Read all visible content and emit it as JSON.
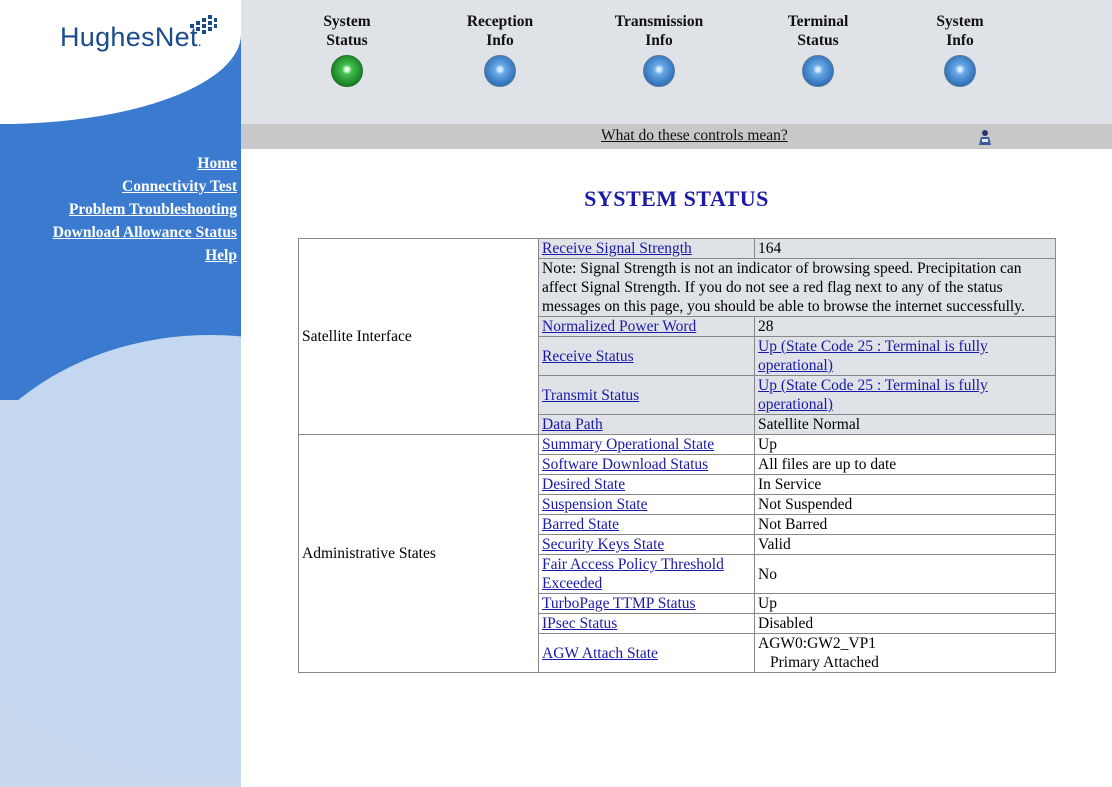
{
  "logo": {
    "text": "HughesNet",
    "trademark": "."
  },
  "sidebar": {
    "links": [
      "Home",
      "Connectivity Test",
      "Problem Troubleshooting",
      "Download Allowance Status",
      "Help"
    ]
  },
  "topnav": {
    "tabs": [
      {
        "label": "System\nStatus",
        "active": true
      },
      {
        "label": "Reception\nInfo",
        "active": false
      },
      {
        "label": "Transmission\nInfo",
        "active": false
      },
      {
        "label": "Terminal\nStatus",
        "active": false
      },
      {
        "label": "System\nInfo",
        "active": false
      }
    ]
  },
  "helpbar": {
    "link": "What do these controls mean?"
  },
  "page_title": "SYSTEM STATUS",
  "table": {
    "satellite": {
      "category": "Satellite Interface",
      "signal": {
        "key": "Receive Signal Strength",
        "value": "164"
      },
      "note": "Note: Signal Strength is not an indicator of browsing speed. Precipitation can affect Signal Strength. If you do not see a red flag next to any of the status messages on this page, you should be able to browse the internet successfully.",
      "rows": [
        {
          "key": "Normalized Power Word",
          "value": "28",
          "link": false
        },
        {
          "key": "Receive Status",
          "value": "Up (State Code 25 : Terminal is fully operational)",
          "link": true
        },
        {
          "key": "Transmit Status",
          "value": "Up (State Code 25 : Terminal is fully operational)",
          "link": true
        },
        {
          "key": "Data Path",
          "value": "Satellite Normal",
          "link": false
        }
      ]
    },
    "admin": {
      "category": "Administrative States",
      "rows": [
        {
          "key": "Summary Operational State",
          "value": "Up"
        },
        {
          "key": "Software Download Status",
          "value": "All files are up to date"
        },
        {
          "key": "Desired State",
          "value": "In Service"
        },
        {
          "key": "Suspension State",
          "value": "Not Suspended"
        },
        {
          "key": "Barred State",
          "value": "Not Barred"
        },
        {
          "key": "Security Keys State",
          "value": "Valid"
        },
        {
          "key": "Fair Access Policy Threshold Exceeded",
          "value": "No"
        },
        {
          "key": "TurboPage TTMP Status",
          "value": "Up"
        },
        {
          "key": "IPsec Status",
          "value": "Disabled"
        },
        {
          "key": "AGW Attach State",
          "value": "AGW0:GW2_VP1",
          "value2": "Primary Attached"
        }
      ]
    }
  },
  "colors": {
    "sidebar_blue": "#3a7bd0",
    "title_blue": "#1a1aa6",
    "active_dot": "#45c04d",
    "inactive_dot": "#2a6cb6"
  },
  "icons": [
    "hughesnet-logo-icon",
    "status-dot-icon",
    "help-person-icon"
  ]
}
